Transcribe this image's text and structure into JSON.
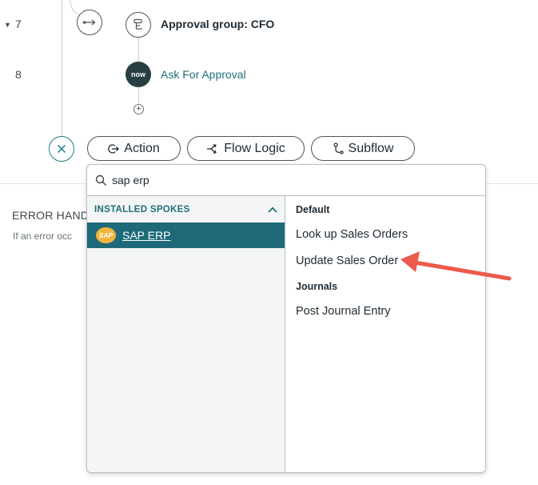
{
  "steps": [
    {
      "number": "7",
      "title": "Approval group: CFO"
    },
    {
      "number": "8",
      "badge": "now",
      "link": "Ask For Approval"
    }
  ],
  "add_buttons": {
    "action": "Action",
    "flow_logic": "Flow Logic",
    "subflow": "Subflow"
  },
  "error_handler": {
    "heading": "ERROR HAND",
    "text": "If an error occ"
  },
  "search": {
    "value": "sap erp"
  },
  "installed_spokes": {
    "header": "INSTALLED SPOKES",
    "items": [
      {
        "logo": "SAP",
        "label": "SAP ERP"
      }
    ]
  },
  "actions": {
    "groups": [
      {
        "label": "Default",
        "items": [
          "Look up Sales Orders",
          "Update Sales Order"
        ]
      },
      {
        "label": "Journals",
        "items": [
          "Post Journal Entry"
        ]
      }
    ]
  },
  "colors": {
    "accent": "#1e6a78",
    "annotation_arrow": "#ec5a4b"
  }
}
